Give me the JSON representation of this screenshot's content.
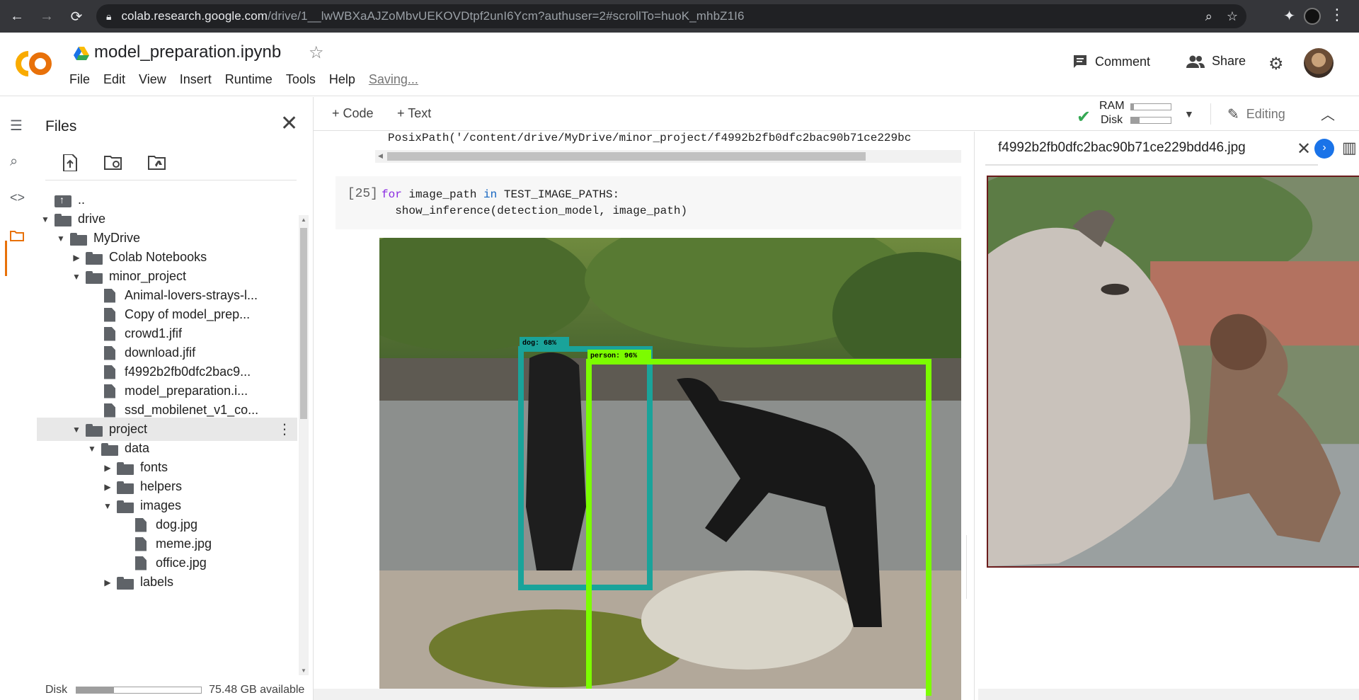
{
  "browser": {
    "url_host": "colab.research.google.com",
    "url_path": "/drive/1__lwWBXaAJZoMbvUEKOVDtpf2unI6Ycm?authuser=2#scrollTo=huoK_mhbZ1I6"
  },
  "header": {
    "notebook_title": "model_preparation.ipynb",
    "menu": [
      "File",
      "Edit",
      "View",
      "Insert",
      "Runtime",
      "Tools",
      "Help"
    ],
    "status": "Saving...",
    "comment_label": "Comment",
    "share_label": "Share"
  },
  "files_panel": {
    "title": "Files",
    "tree": [
      {
        "label": "..",
        "type": "updir",
        "depth": 0,
        "caret": ""
      },
      {
        "label": "drive",
        "type": "folder",
        "depth": 0,
        "caret": "open"
      },
      {
        "label": "MyDrive",
        "type": "folder",
        "depth": 1,
        "caret": "open"
      },
      {
        "label": "Colab Notebooks",
        "type": "folder",
        "depth": 2,
        "caret": "closed"
      },
      {
        "label": "minor_project",
        "type": "folder",
        "depth": 2,
        "caret": "open"
      },
      {
        "label": "Animal-lovers-strays-l...",
        "type": "file",
        "depth": 3,
        "caret": ""
      },
      {
        "label": "Copy of model_prep...",
        "type": "file",
        "depth": 3,
        "caret": ""
      },
      {
        "label": "crowd1.jfif",
        "type": "file",
        "depth": 3,
        "caret": ""
      },
      {
        "label": "download.jfif",
        "type": "file",
        "depth": 3,
        "caret": ""
      },
      {
        "label": "f4992b2fb0dfc2bac9...",
        "type": "file",
        "depth": 3,
        "caret": ""
      },
      {
        "label": "model_preparation.i...",
        "type": "file",
        "depth": 3,
        "caret": ""
      },
      {
        "label": "ssd_mobilenet_v1_co...",
        "type": "file",
        "depth": 3,
        "caret": ""
      },
      {
        "label": "project",
        "type": "folder",
        "depth": 2,
        "caret": "open",
        "selected": true
      },
      {
        "label": "data",
        "type": "folder",
        "depth": 3,
        "caret": "open"
      },
      {
        "label": "fonts",
        "type": "folder",
        "depth": 4,
        "caret": "closed"
      },
      {
        "label": "helpers",
        "type": "folder",
        "depth": 4,
        "caret": "closed"
      },
      {
        "label": "images",
        "type": "folder",
        "depth": 4,
        "caret": "open"
      },
      {
        "label": "dog.jpg",
        "type": "file",
        "depth": 5,
        "caret": ""
      },
      {
        "label": "meme.jpg",
        "type": "file",
        "depth": 5,
        "caret": ""
      },
      {
        "label": "office.jpg",
        "type": "file",
        "depth": 5,
        "caret": ""
      },
      {
        "label": "labels",
        "type": "folder",
        "depth": 4,
        "caret": "closed"
      }
    ],
    "disk_label": "Disk",
    "disk_available": "75.48 GB available",
    "disk_used_fraction": 0.3
  },
  "toolbar": {
    "add_code": "Code",
    "add_text": "Text",
    "ram_label": "RAM",
    "disk_label": "Disk",
    "ram_used_fraction": 0.08,
    "disk_used_fraction": 0.22,
    "editing_label": "Editing"
  },
  "notebook": {
    "prev_output": "PosixPath('/content/drive/MyDrive/minor_project/f4992b2fb0dfc2bac90b71ce229bc",
    "cell_exec_count": "[25]",
    "cell_line1_kw1": "for",
    "cell_line1_mid": " image_path ",
    "cell_line1_kw2": "in",
    "cell_line1_end": " TEST_IMAGE_PATHS:",
    "cell_line2": "  show_inference(detection_model, image_path)",
    "detections": [
      {
        "label": "dog: 68%",
        "color": "#1aa39a"
      },
      {
        "label": "person: 96%",
        "color": "#7cfc00"
      }
    ]
  },
  "viewer": {
    "filename": "f4992b2fb0dfc2bac90b71ce229bdd46.jpg"
  },
  "colors": {
    "accent_orange": "#e8710a",
    "check_green": "#34a853",
    "viewer_next_blue": "#1a73e8"
  }
}
